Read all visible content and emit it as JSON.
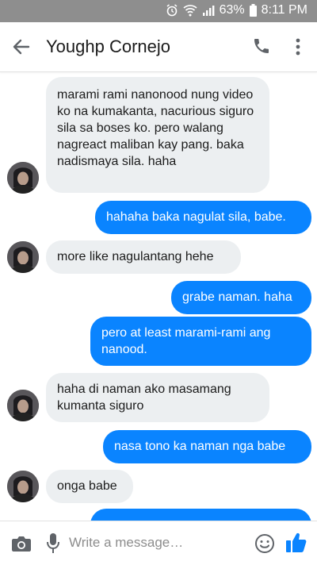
{
  "status": {
    "battery": "63%",
    "time": "8:11 PM"
  },
  "header": {
    "contact_name": "Youghp Cornejo"
  },
  "messages": [
    {
      "dir": "in",
      "text": "marami rami nanonood nung video ko na kumakanta, nacurious siguro sila sa boses ko. pero walang nagreact maliban kay pang. baka nadismaya sila. haha"
    },
    {
      "dir": "out",
      "text": "hahaha baka nagulat sila, babe."
    },
    {
      "dir": "in",
      "text": "more like nagulantang hehe"
    },
    {
      "dir": "out",
      "text": "grabe naman. haha"
    },
    {
      "dir": "out",
      "text": "pero at least marami-rami ang nanood."
    },
    {
      "dir": "in",
      "text": "haha di naman ako masamang kumanta siguro"
    },
    {
      "dir": "out",
      "text": "nasa tono ka naman nga babe"
    },
    {
      "dir": "in",
      "text": "onga babe"
    }
  ],
  "composer": {
    "placeholder": "Write a message…"
  },
  "icons": {
    "back": "arrow-left-icon",
    "call": "phone-icon",
    "more": "more-vertical-icon",
    "camera": "camera-icon",
    "mic": "microphone-icon",
    "emoji": "emoji-icon",
    "like": "thumbs-up-icon"
  },
  "colors": {
    "outgoing": "#0a84ff",
    "incoming": "#eceff1",
    "statusbar": "#8e8e8e"
  }
}
